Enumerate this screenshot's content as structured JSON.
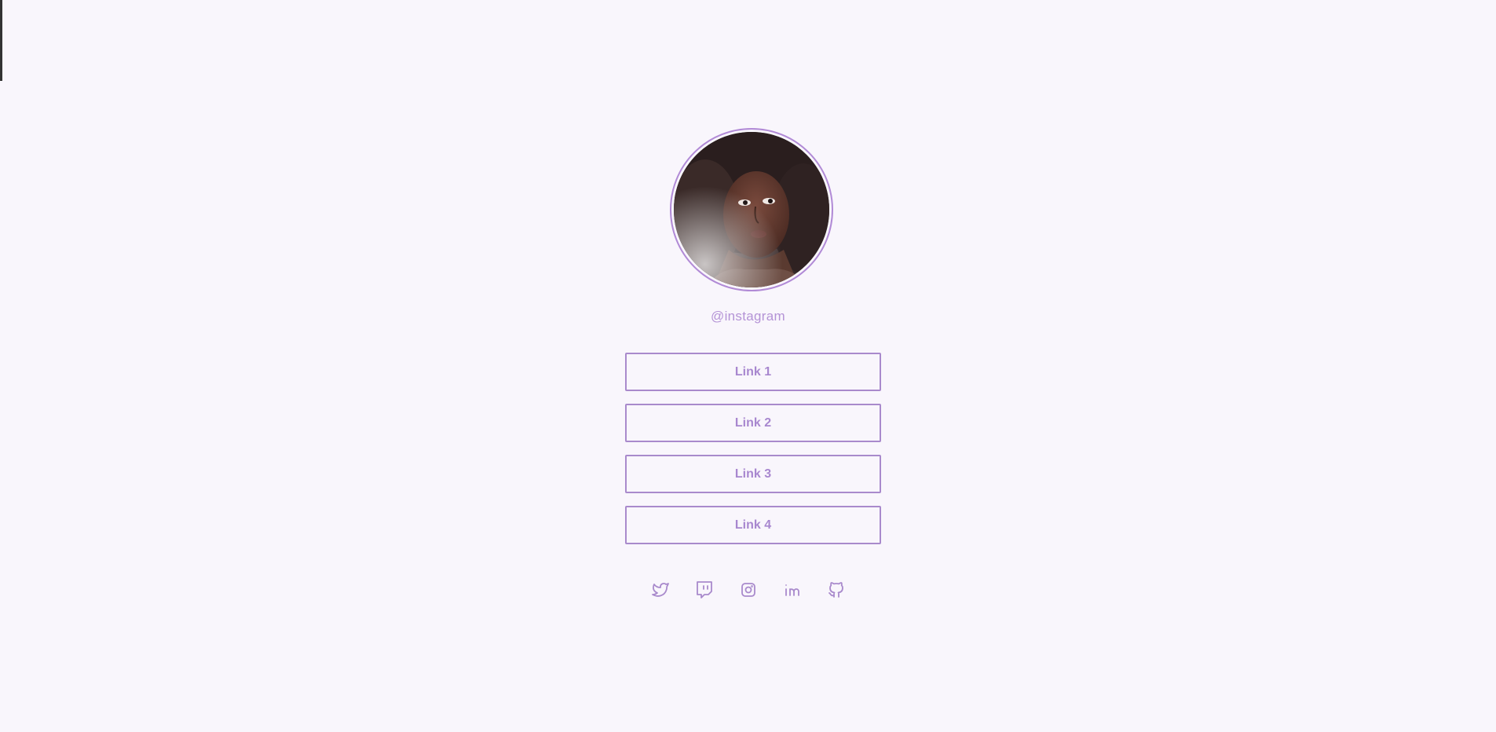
{
  "profile": {
    "handle": "@instagram",
    "avatar_alt": "profile-photo"
  },
  "links": [
    {
      "label": "Link 1"
    },
    {
      "label": "Link 2"
    },
    {
      "label": "Link 3"
    },
    {
      "label": "Link 4"
    }
  ],
  "socials": [
    {
      "icon": "twitter-icon"
    },
    {
      "icon": "twitch-icon"
    },
    {
      "icon": "instagram-icon"
    },
    {
      "icon": "linkedin-icon"
    },
    {
      "icon": "github-icon"
    }
  ],
  "colors": {
    "background": "#f9f6fc",
    "accent": "#a98acc"
  }
}
